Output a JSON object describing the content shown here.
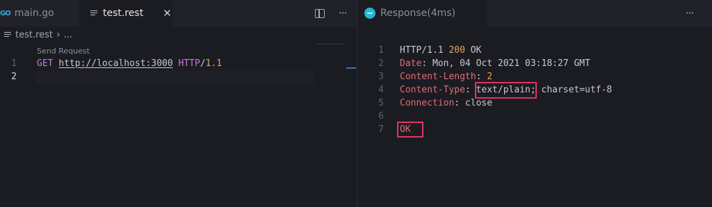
{
  "left_editor": {
    "tabs": [
      {
        "label": "main.go",
        "icon": "go-icon",
        "active": false
      },
      {
        "label": "test.rest",
        "icon": "lines-icon",
        "active": true
      }
    ],
    "close_symbol": "✕",
    "more_symbol": "···",
    "breadcrumb": {
      "file": "test.rest",
      "separator": "›",
      "more": "..."
    },
    "codelens": "Send Request",
    "line_numbers": [
      "1",
      "2"
    ],
    "line1": {
      "method": "GET",
      "url": "http://localhost:3000",
      "protocol": "HTTP",
      "slash": "/",
      "version": "1.1"
    }
  },
  "right_editor": {
    "tab": {
      "label": "Response(4ms)",
      "icon": "response-icon"
    },
    "more_symbol": "···",
    "line_numbers": [
      "1",
      "2",
      "3",
      "4",
      "5",
      "6",
      "7"
    ],
    "status_line": {
      "protocol": "HTTP/1.1",
      "code": "200",
      "text": "OK"
    },
    "headers": [
      {
        "name": "Date",
        "value": "Mon, 04 Oct 2021 03:18:27 GMT"
      },
      {
        "name": "Content-Length",
        "value": "2"
      },
      {
        "name": "Content-Type",
        "value_main": "text/plain;",
        "value_rest": " charset=utf-8"
      },
      {
        "name": "Connection",
        "value": "close"
      }
    ],
    "colon": ": ",
    "body": "OK"
  },
  "colors": {
    "background": "#1b1c22",
    "keyword": "#c678dd",
    "number": "#e5a35e",
    "header_name": "#e06c75",
    "highlight_box": "#e6335f",
    "accent": "#3a71c9"
  }
}
